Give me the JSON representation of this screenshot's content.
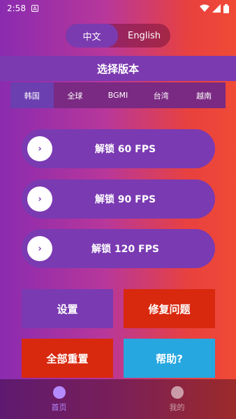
{
  "status": {
    "time": "2:58",
    "notif_icon_label": "A"
  },
  "lang": {
    "zh": "中文",
    "en": "English"
  },
  "title": "选择版本",
  "regions": [
    "韩国",
    "全球",
    "BGMI",
    "台湾",
    "越南"
  ],
  "fps_buttons": [
    "解锁 60 FPS",
    "解锁 90 FPS",
    "解锁 120 FPS"
  ],
  "fps_arrow": "›",
  "actions": {
    "settings": "设置",
    "fix": "修复问题",
    "reset": "全部重置",
    "help": "帮助?"
  },
  "nav": {
    "home": "首页",
    "mine": "我的"
  },
  "colors": {
    "settings_bg": "#7a3ab2",
    "fix_bg": "#d8280e",
    "reset_bg": "#d8280e",
    "help_bg": "#27a7e0",
    "nav_active": "#b58aff"
  }
}
